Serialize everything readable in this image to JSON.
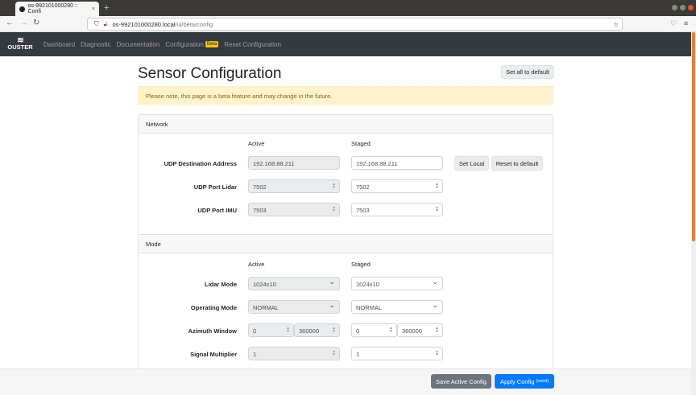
{
  "browser": {
    "tab_title": "os-992101000280 :: Confi",
    "url_host": "os-992101000280.local",
    "url_path": "/ui/beta/config"
  },
  "nav": {
    "logo": "OUSTER",
    "items": [
      "Dashboard",
      "Diagnostic",
      "Documentation",
      "Configuration",
      "Reset Configuration"
    ],
    "beta_badge": "Beta"
  },
  "page": {
    "title": "Sensor Configuration",
    "set_all_default": "Set all to default",
    "alert": "Please note, this page is a beta feature and may change in the future."
  },
  "network": {
    "header": "Network",
    "active": "Active",
    "staged": "Staged",
    "udp_dest": {
      "label": "UDP Destination Address",
      "active": "192.168.88.211",
      "staged": "192.168.88.211",
      "set_local": "Set Local",
      "reset": "Reset to default"
    },
    "lidar_port": {
      "label": "UDP Port Lidar",
      "active": "7502",
      "staged": "7502"
    },
    "imu_port": {
      "label": "UDP Port IMU",
      "active": "7503",
      "staged": "7503"
    }
  },
  "mode": {
    "header": "Mode",
    "active": "Active",
    "staged": "Staged",
    "lidar_mode": {
      "label": "Lidar Mode",
      "active": "1024x10",
      "staged": "1024x10"
    },
    "operating_mode": {
      "label": "Operating Mode",
      "active": "NORMAL",
      "staged": "NORMAL"
    },
    "azimuth": {
      "label": "Azimuth Window",
      "active_min": "0",
      "active_max": "360000",
      "staged_min": "0",
      "staged_max": "360000"
    },
    "signal_mult": {
      "label": "Signal Multiplier",
      "active": "1",
      "staged": "1"
    }
  },
  "footer": {
    "save": "Save Active Config",
    "apply": "Apply Config",
    "apply_note": "(reinit)"
  }
}
